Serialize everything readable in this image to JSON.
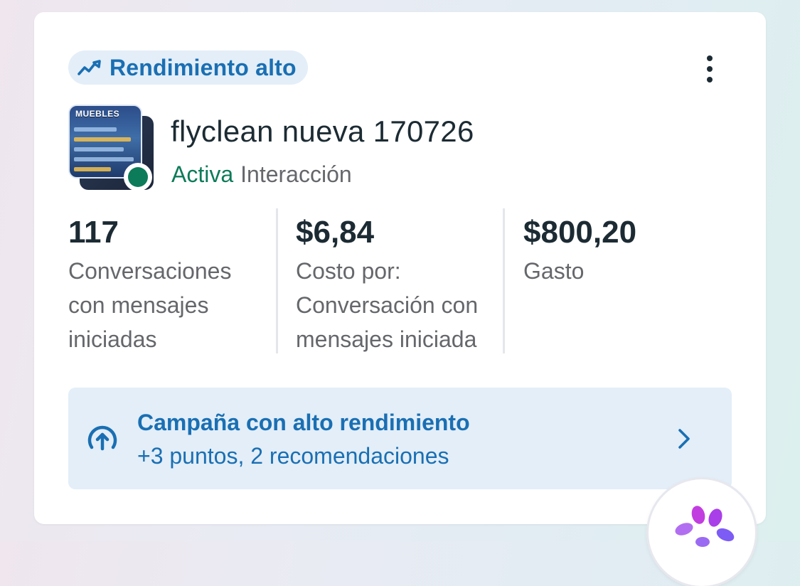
{
  "badge": {
    "label": "Rendimiento alto",
    "icon": "trending-up-icon",
    "color": "#1a6fb3"
  },
  "campaign": {
    "name": "flyclean nueva 170726",
    "status": "Activa",
    "objective": "Interacción",
    "status_color": "#0c7b59",
    "thumbnail_text": "MUEBLES"
  },
  "metrics": [
    {
      "value": "117",
      "label_lines": [
        "Conversaciones",
        "con mensajes",
        "iniciadas"
      ]
    },
    {
      "value": "$6,84",
      "label_lines": [
        "Costo por:",
        "Conversación con",
        "mensajes iniciada"
      ]
    },
    {
      "value": "$800,20",
      "label_lines": [
        "Gasto"
      ]
    }
  ],
  "recommendation": {
    "title": "Campaña con alto rendimiento",
    "subtitle": "+3 puntos, 2 recomendaciones",
    "icon": "arrow-up-circle-icon",
    "chevron": "chevron-right-icon"
  },
  "menu": {
    "icon": "more-vertical-icon"
  },
  "assistant": {
    "icon": "meta-ai-icon"
  }
}
